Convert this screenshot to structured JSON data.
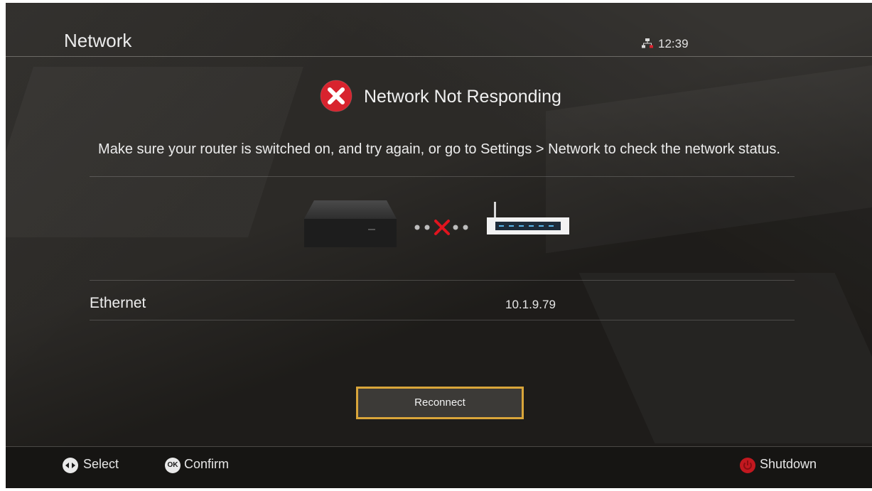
{
  "header": {
    "title": "Network",
    "time": "12:39"
  },
  "error": {
    "title": "Network Not Responding",
    "message": "Make sure your router is switched on, and try again, or go to Settings > Network to check the network status."
  },
  "connection": {
    "type_label": "Ethernet",
    "ip_address": "10.1.9.79"
  },
  "actions": {
    "reconnect_label": "Reconnect"
  },
  "footer": {
    "select_label": "Select",
    "confirm_key": "OK",
    "confirm_label": "Confirm",
    "shutdown_label": "Shutdown"
  },
  "colors": {
    "accent_focus": "#d9a53a",
    "error_red": "#d8232e"
  }
}
